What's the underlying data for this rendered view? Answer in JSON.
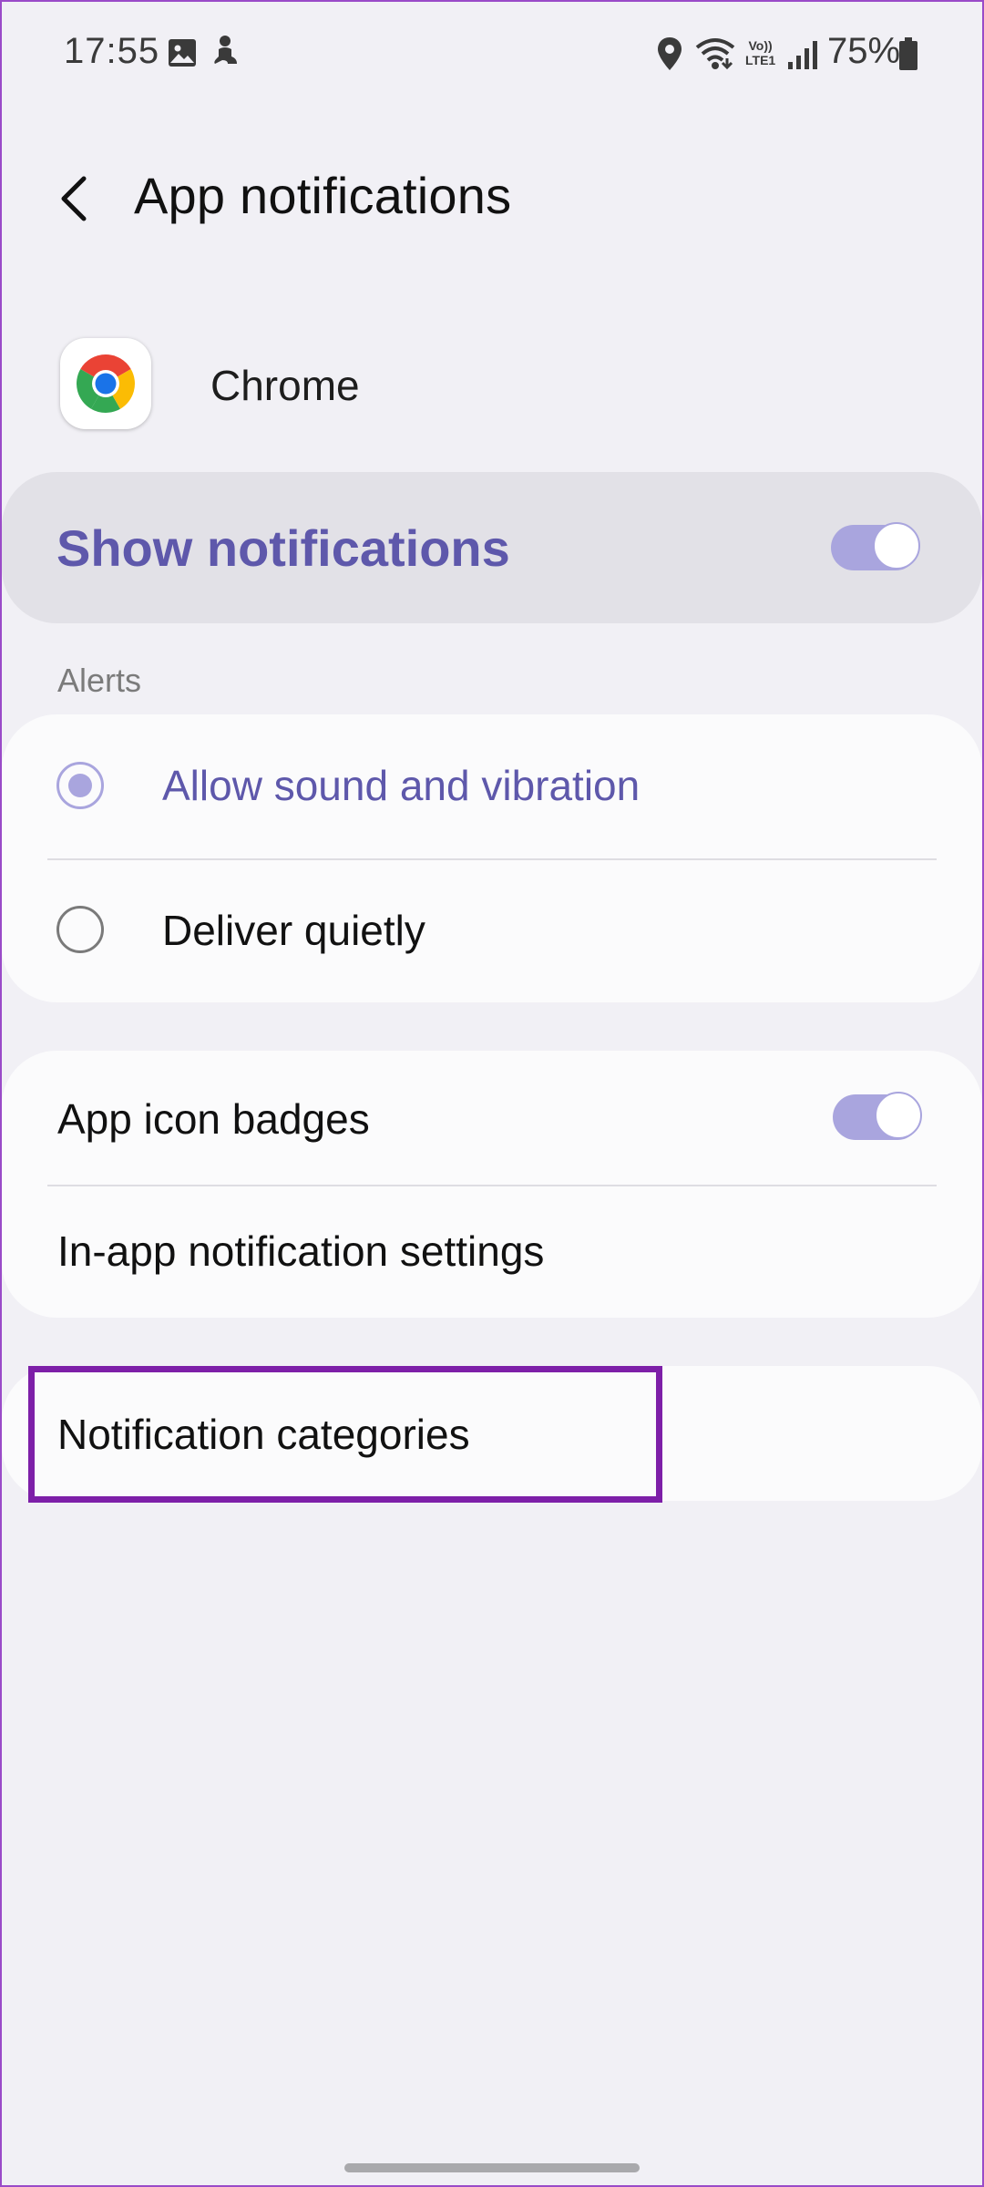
{
  "status_bar": {
    "time": "17:55",
    "volte_top": "Vo))",
    "volte_bottom": "LTE1",
    "battery_percent": "75%",
    "icons": [
      "gallery-icon",
      "notification-person-icon",
      "location-icon",
      "wifi-icon",
      "volte-icon",
      "signal-icon",
      "battery-icon"
    ]
  },
  "header": {
    "back_icon": "chevron-left-icon",
    "title": "App notifications"
  },
  "app": {
    "name": "Chrome",
    "icon": "chrome-icon"
  },
  "show_notifications": {
    "label": "Show notifications",
    "enabled": true
  },
  "alerts": {
    "header": "Alerts",
    "options": [
      {
        "label": "Allow sound and vibration",
        "selected": true
      },
      {
        "label": "Deliver quietly",
        "selected": false
      }
    ]
  },
  "settings": {
    "app_icon_badges": {
      "label": "App icon badges",
      "enabled": true
    },
    "in_app_settings": {
      "label": "In-app notification settings"
    }
  },
  "categories": {
    "label": "Notification categories",
    "highlighted": true
  },
  "colors": {
    "accent": "#5e58ab",
    "toggle_on": "#a9a5de",
    "highlight": "#7d1fa8",
    "background": "#f1f0f5"
  }
}
